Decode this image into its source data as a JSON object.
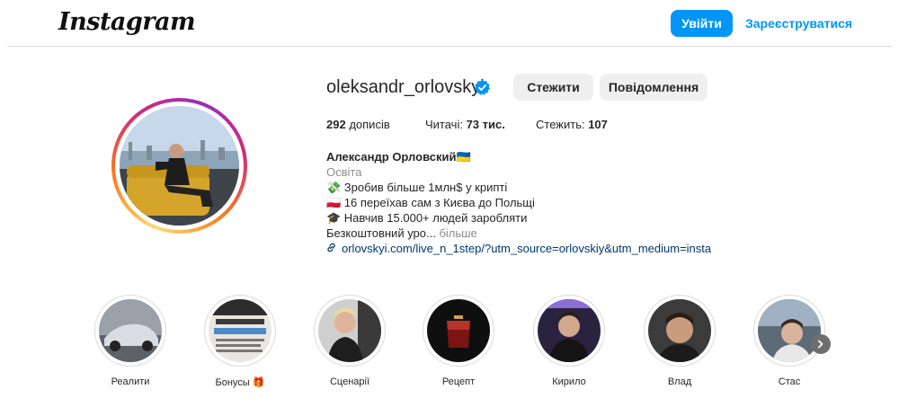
{
  "header": {
    "logo_text": "Instagram",
    "login_label": "Увійти",
    "signup_label": "Зареєструватися",
    "accent_color": "#0095f6"
  },
  "profile": {
    "username": "oleksandr_orlovskyi",
    "verified": true,
    "follow_label": "Стежити",
    "message_label": "Повідомлення",
    "stats": {
      "posts_count": "292",
      "posts_label": "дописів",
      "followers_label": "Читачі:",
      "followers_count": "73 тис.",
      "following_label": "Стежить:",
      "following_count": "107"
    },
    "bio": {
      "name": "Александр Орловский🇺🇦",
      "category": "Освіта",
      "line1": "💸 Зробив більше 1млн$ у крипті",
      "line2": "🇵🇱 16 переїхав сам з Києва до Польщі",
      "line3": "🎓 Навчив 15.000+ людей заробляти",
      "line4": "Безкоштовний уро...",
      "more_label": " більше",
      "link": "orlovskyi.com/live_n_1step/?utm_source=orlovskiy&utm_medium=insta"
    }
  },
  "highlights": [
    {
      "label": "Реалити",
      "icon": "car-photo"
    },
    {
      "label": "Бонусы 🎁",
      "icon": "text-card-photo"
    },
    {
      "label": "Сценарії",
      "icon": "man-photo"
    },
    {
      "label": "Рецепт",
      "icon": "cocktail-photo"
    },
    {
      "label": "Кирило",
      "icon": "man-photo"
    },
    {
      "label": "Влад",
      "icon": "man-photo"
    },
    {
      "label": "Стас",
      "icon": "man-photo"
    }
  ],
  "icons": {
    "verified": "verified-badge-icon",
    "link": "link-icon",
    "next": "chevron-right-icon"
  }
}
